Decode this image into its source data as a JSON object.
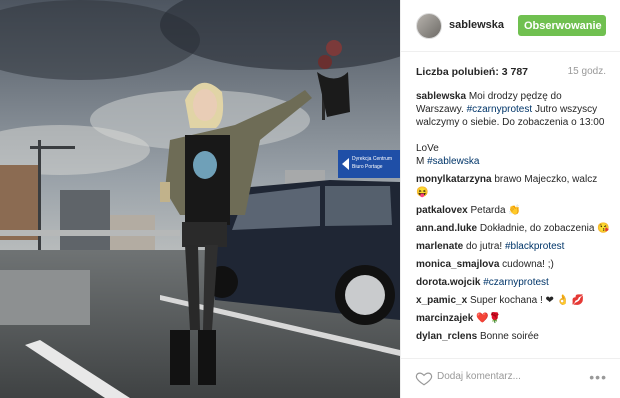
{
  "header": {
    "username": "sablewska",
    "follow_label": "Obserwowanie"
  },
  "stats": {
    "likes_label": "Liczba polubień: 3 787",
    "time": "15 godz."
  },
  "caption": {
    "user": "sablewska",
    "text1": "Moi drodzy pędzę do Warszawy.",
    "tag1": "#czarnyprotest",
    "text2": "Jutro wszyscy walczymy o siebie. Do zobaczenia o 13:00",
    "text3": "LoVe",
    "text4": "M",
    "tag2": "#sablewska"
  },
  "comments": [
    {
      "user": "monylkatarzyna",
      "text": "brawo Majeczko, walcz 😝"
    },
    {
      "user": "patkalovex",
      "text": "Petarda 👏"
    },
    {
      "user": "ann.and.luke",
      "text": "Dokładnie, do zobaczenia 😘"
    },
    {
      "user": "marlenate",
      "text": "do jutra!",
      "tag": "#blackprotest"
    },
    {
      "user": "monica_smajlova",
      "text": "cudowna! ;)"
    },
    {
      "user": "dorota.wojcik",
      "text": "",
      "tag": "#czarnyprotest"
    },
    {
      "user": "x_pamic_x",
      "text": "Super kochana ! ❤ 👌 💋"
    },
    {
      "user": "marcinzajek",
      "text": "❤️🌹"
    },
    {
      "user": "dylan_rclens",
      "text": "Bonne soirée"
    }
  ],
  "photo_sign": {
    "line1": "Dyrekcja Centrum",
    "line2": "Biuro Portage"
  },
  "footer": {
    "add_comment_placeholder": "Dodaj komentarz...",
    "more": "•••"
  }
}
